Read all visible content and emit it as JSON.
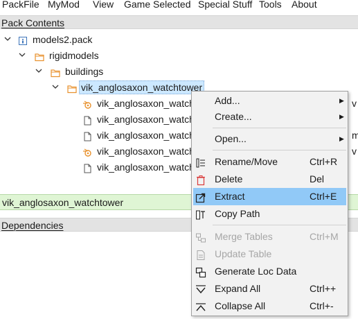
{
  "menubar": {
    "items": [
      "PackFile",
      "MyMod",
      "View",
      "Game Selected",
      "Special Stuff",
      "Tools",
      "About"
    ]
  },
  "pack_contents": {
    "title": "Pack Contents",
    "tree": {
      "root": "models2.pack",
      "folder1": "rigidmodels",
      "folder2": "buildings",
      "folder3": "vik_anglosaxon_watchtower",
      "files": [
        "vik_anglosaxon_watch",
        "vik_anglosaxon_watch",
        "vik_anglosaxon_watch",
        "vik_anglosaxon_watch",
        "vik_anglosaxon_watch"
      ],
      "overflow_letters": [
        "v",
        "",
        "m",
        "v",
        ""
      ]
    }
  },
  "status": {
    "path": "vik_anglosaxon_watchtower"
  },
  "dependencies": {
    "title": "Dependencies"
  },
  "context_menu": {
    "items": [
      {
        "label": "Add...",
        "shortcut": "",
        "submenu": true,
        "icon": ""
      },
      {
        "label": "Create...",
        "shortcut": "",
        "submenu": true,
        "icon": ""
      },
      {
        "label": "Open...",
        "shortcut": "",
        "submenu": true,
        "icon": ""
      },
      {
        "label": "Rename/Move",
        "shortcut": "Ctrl+R",
        "icon": "rename-icon"
      },
      {
        "label": "Delete",
        "shortcut": "Del",
        "icon": "delete-icon"
      },
      {
        "label": "Extract",
        "shortcut": "Ctrl+E",
        "icon": "extract-icon"
      },
      {
        "label": "Copy Path",
        "shortcut": "",
        "icon": "copy-path-icon"
      },
      {
        "label": "Merge Tables",
        "shortcut": "Ctrl+M",
        "icon": "merge-icon",
        "disabled": true
      },
      {
        "label": "Update Table",
        "shortcut": "",
        "icon": "update-icon",
        "disabled": true
      },
      {
        "label": "Generate Loc Data",
        "shortcut": "",
        "icon": "generate-icon"
      },
      {
        "label": "Expand All",
        "shortcut": "Ctrl++",
        "icon": "expand-icon"
      },
      {
        "label": "Collapse All",
        "shortcut": "Ctrl+-",
        "icon": "collapse-icon"
      }
    ],
    "submenu_arrow": "▶"
  },
  "colors": {
    "highlight": "#91c9f7",
    "folder": "#e8912d",
    "status_bg": "#dff5d4",
    "delete_red": "#d93a3a"
  }
}
